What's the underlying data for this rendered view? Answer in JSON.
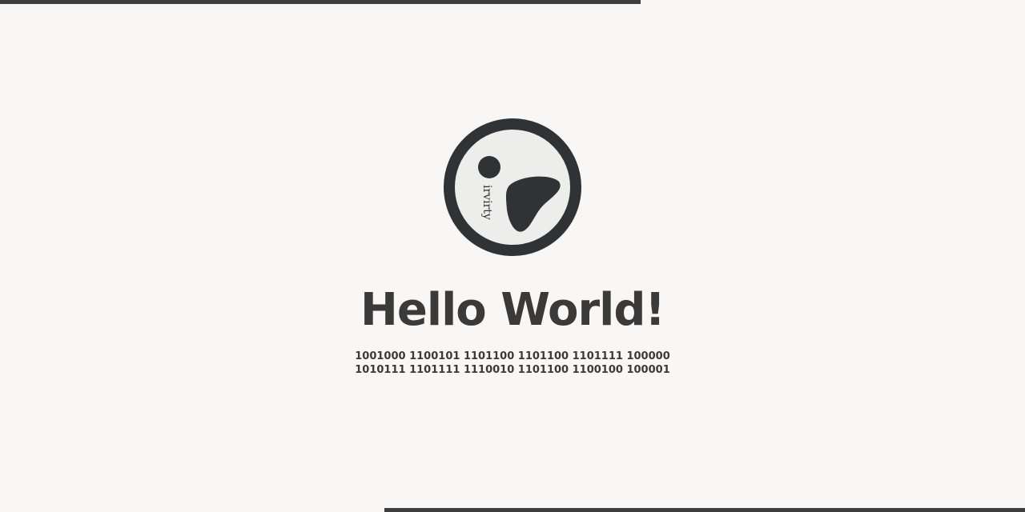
{
  "brand": {
    "logo_text": "irvirty",
    "colors": {
      "ring": "#2f3336",
      "inner": "#ededeb",
      "background": "#f8f7f5",
      "text": "#3a3a3a",
      "bars": "#3d3d3d"
    }
  },
  "main": {
    "title": "Hello World!",
    "binary_lines": [
      "1001000 1100101 1101100 1101100 1101111 100000",
      "1010111 1101111 1110010 1101100 1100100 100001"
    ]
  }
}
